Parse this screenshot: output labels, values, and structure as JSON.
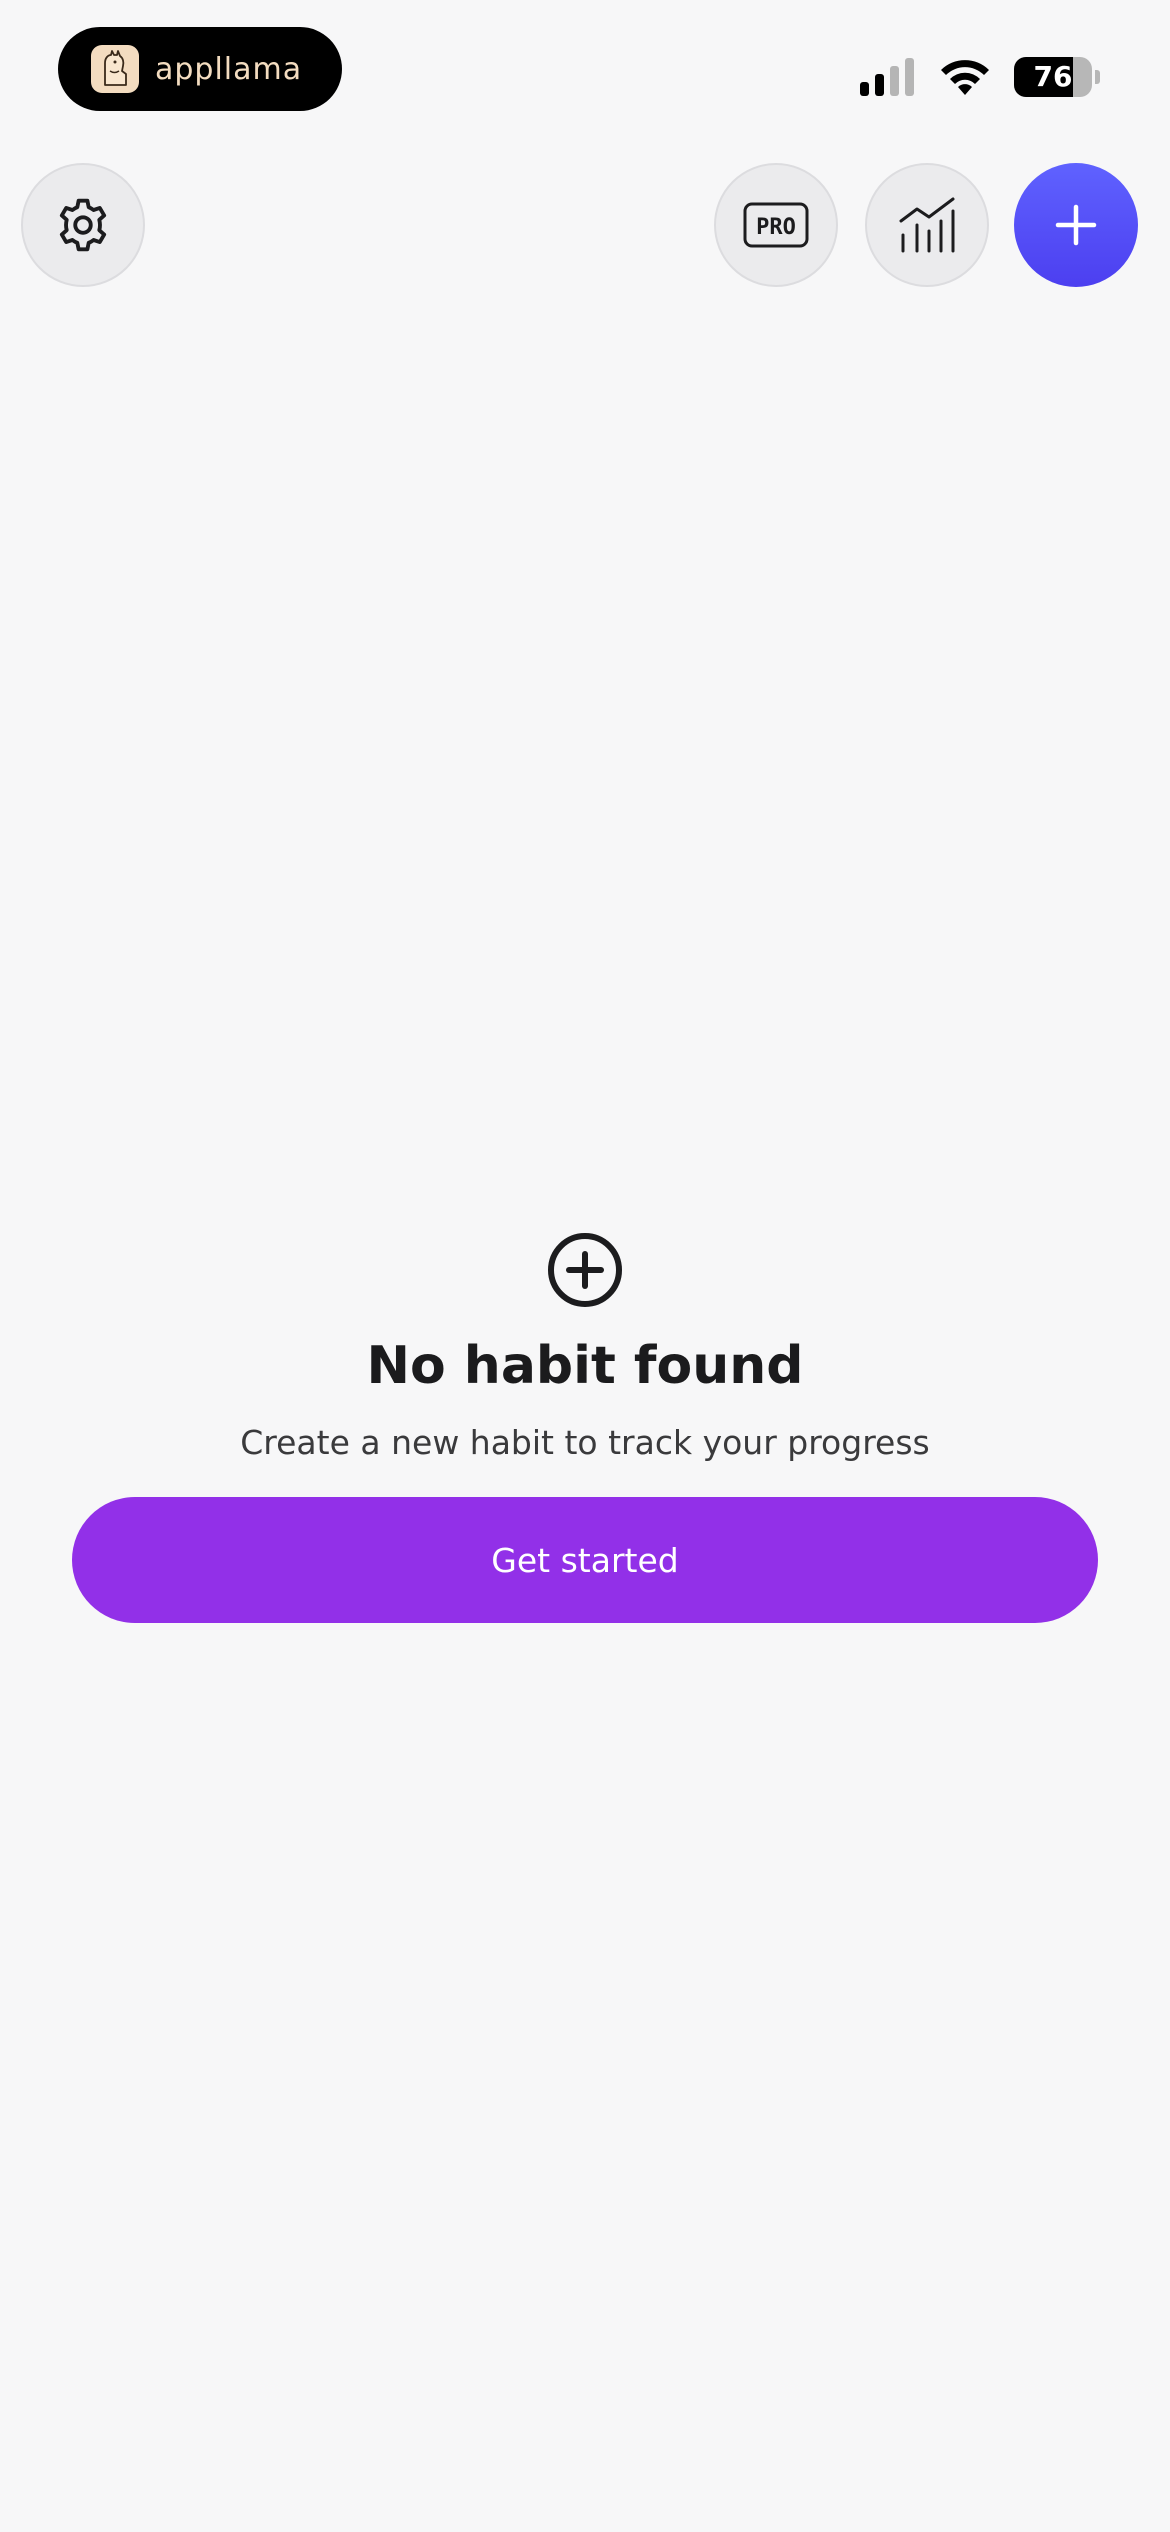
{
  "status_bar": {
    "carrier_label": "appllama",
    "battery_level": 76,
    "battery_label": "76",
    "signal_bars_active": 2,
    "signal_bars_total": 4
  },
  "toolbar": {
    "settings_icon": "gear-icon",
    "pro_badge_label": "PRO",
    "stats_icon": "chart-icon",
    "add_icon": "plus-icon"
  },
  "empty_state": {
    "icon": "plus-circle-icon",
    "title": "No habit found",
    "subtitle": "Create a new habit to track your progress",
    "cta_label": "Get started"
  },
  "colors": {
    "background": "#f7f7f8",
    "accent_blue": "#5b5cfb",
    "cta_purple": "#9230e8"
  }
}
